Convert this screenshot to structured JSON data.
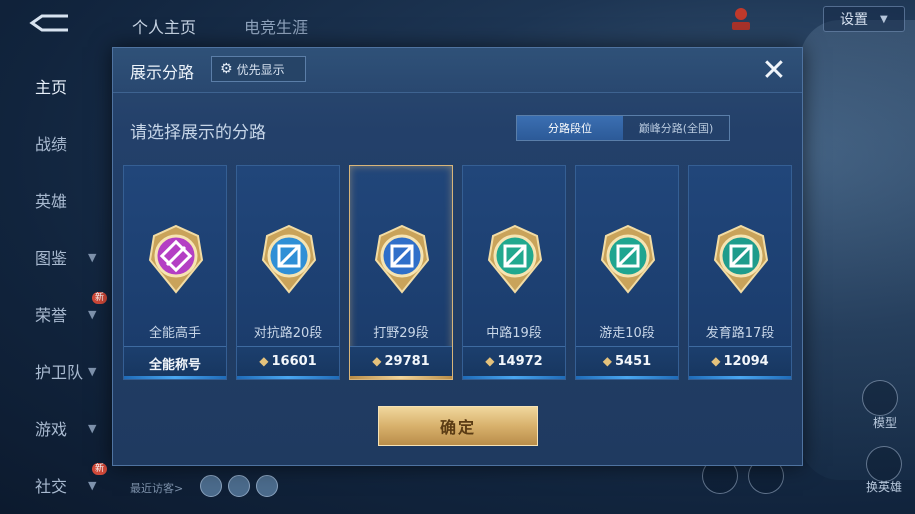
{
  "top_tabs": [
    "个人主页",
    "电竞生涯"
  ],
  "settings_label": "设置",
  "sidebar": [
    {
      "label": "主页",
      "active": true,
      "chevron": false,
      "new": false
    },
    {
      "label": "战绩",
      "active": false,
      "chevron": false,
      "new": false
    },
    {
      "label": "英雄",
      "active": false,
      "chevron": false,
      "new": false
    },
    {
      "label": "图鉴",
      "active": false,
      "chevron": true,
      "new": false
    },
    {
      "label": "荣誉",
      "active": false,
      "chevron": true,
      "new": true
    },
    {
      "label": "护卫队",
      "active": false,
      "chevron": true,
      "new": false
    },
    {
      "label": "游戏",
      "active": false,
      "chevron": true,
      "new": false
    },
    {
      "label": "社交",
      "active": false,
      "chevron": true,
      "new": true
    }
  ],
  "new_badge": "新",
  "visitors_label": "最近访客>",
  "right_tools": {
    "model": "模型",
    "change_hero": "换英雄"
  },
  "dialog": {
    "title": "展示分路",
    "priority_label": "优先显示",
    "subtitle": "请选择展示的分路",
    "segments": [
      {
        "label": "分路段位",
        "active": true
      },
      {
        "label": "巅峰分路(全国)",
        "active": false
      }
    ],
    "cards": [
      {
        "name": "全能高手",
        "score": "全能称号",
        "has_points": false,
        "selected": false,
        "color": "#b43fc4",
        "icon": "all-round-icon"
      },
      {
        "name": "对抗路20段",
        "score": "16601",
        "has_points": true,
        "selected": false,
        "color": "#2f8fd6",
        "icon": "clash-lane-icon"
      },
      {
        "name": "打野29段",
        "score": "29781",
        "has_points": true,
        "selected": true,
        "color": "#2f6fc9",
        "icon": "jungle-icon"
      },
      {
        "name": "中路19段",
        "score": "14972",
        "has_points": true,
        "selected": false,
        "color": "#21a88e",
        "icon": "mid-lane-icon"
      },
      {
        "name": "游走10段",
        "score": "5451",
        "has_points": true,
        "selected": false,
        "color": "#1fa590",
        "icon": "roam-icon"
      },
      {
        "name": "发育路17段",
        "score": "12094",
        "has_points": true,
        "selected": false,
        "color": "#1f9c8c",
        "icon": "farm-lane-icon"
      }
    ],
    "confirm_label": "确定"
  }
}
